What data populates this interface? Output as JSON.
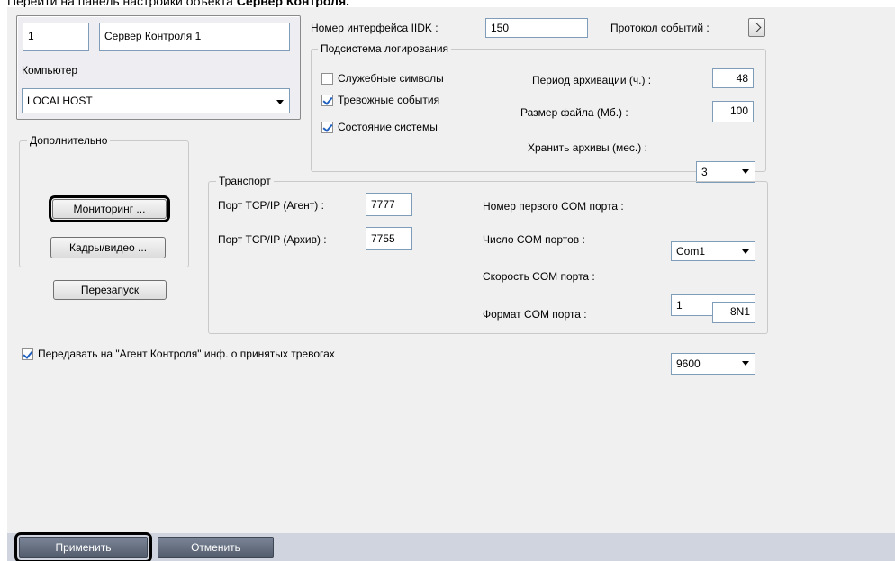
{
  "caption": {
    "text": "Перейти на панель настройки объекта ",
    "bold": "Сервер Контроля."
  },
  "server": {
    "id": "1",
    "name": "Сервер Контроля 1",
    "computer_label": "Компьютер",
    "computer_value": "LOCALHOST"
  },
  "extra": {
    "label": "Дополнительно",
    "monitoring_button": "Мониторинг ...",
    "frames_button": "Кадры/видео ...",
    "restart_button": "Перезапуск"
  },
  "iidk": {
    "label": "Номер интерфейса IIDK :",
    "value": "150",
    "protocol_label": "Протокол событий :"
  },
  "logging": {
    "label": "Подсистема логирования",
    "service_symbols": {
      "label": "Служебные символы",
      "checked": false
    },
    "alarm_events": {
      "label": "Тревожные события",
      "checked": true
    },
    "system_state": {
      "label": "Состояние системы",
      "checked": true
    },
    "archive_period_label": "Период архивации (ч.) :",
    "archive_period_value": "48",
    "file_size_label": "Размер файла (Мб.) :",
    "file_size_value": "100",
    "keep_archives_label": "Хранить архивы (мес.) :",
    "keep_archives_value": "3"
  },
  "transport": {
    "label": "Транспорт",
    "tcp_agent_label": "Порт TCP/IP (Агент) :",
    "tcp_agent_value": "7777",
    "tcp_archive_label": "Порт TCP/IP (Архив) :",
    "tcp_archive_value": "7755",
    "first_com_label": "Номер первого COM порта :",
    "first_com_value": "Com1",
    "com_count_label": "Число COM портов :",
    "com_count_value": "1",
    "com_speed_label": "Скорость COM порта :",
    "com_speed_value": "9600",
    "com_format_label": "Формат COM порта :",
    "com_format_value": "8N1"
  },
  "forward_alarms": {
    "label": "Передавать на \"Агент Контроля\" инф. о принятых тревогах",
    "checked": true
  },
  "bottom": {
    "apply": "Применить",
    "cancel": "Отменить"
  }
}
